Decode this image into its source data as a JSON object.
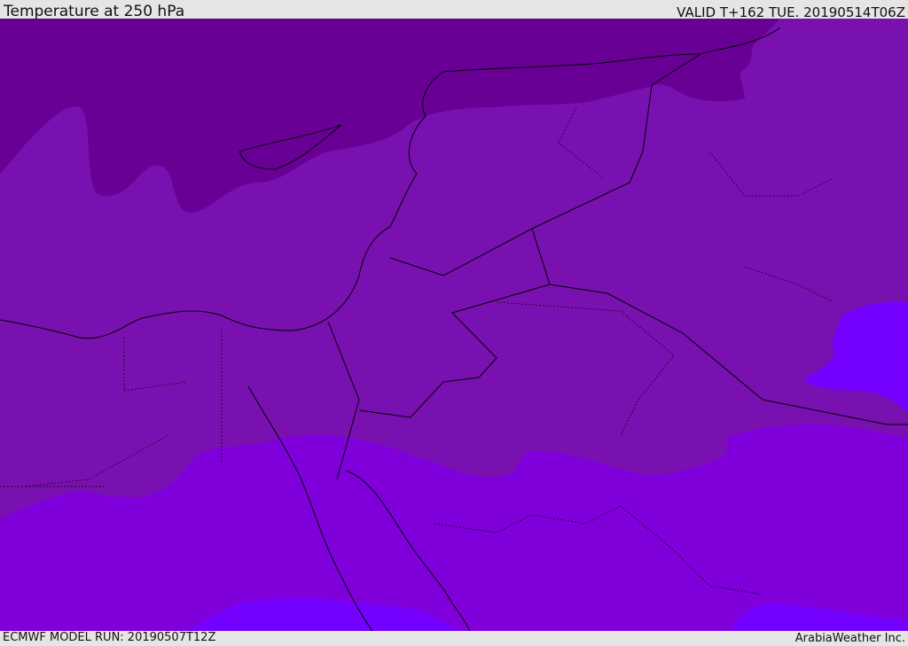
{
  "header": {
    "title": "Temperature at 250 hPa",
    "valid": "VALID T+162 TUE. 20190514T06Z"
  },
  "footer": {
    "model_run": "ECMWF MODEL RUN: 20190507T12Z",
    "brand": "ArabiaWeather Inc."
  },
  "map": {
    "colors": {
      "coldest": "#690096",
      "cold": "#7911b1",
      "mid": "#7f00db",
      "warm": "#7400ff",
      "border": "#000000"
    }
  }
}
